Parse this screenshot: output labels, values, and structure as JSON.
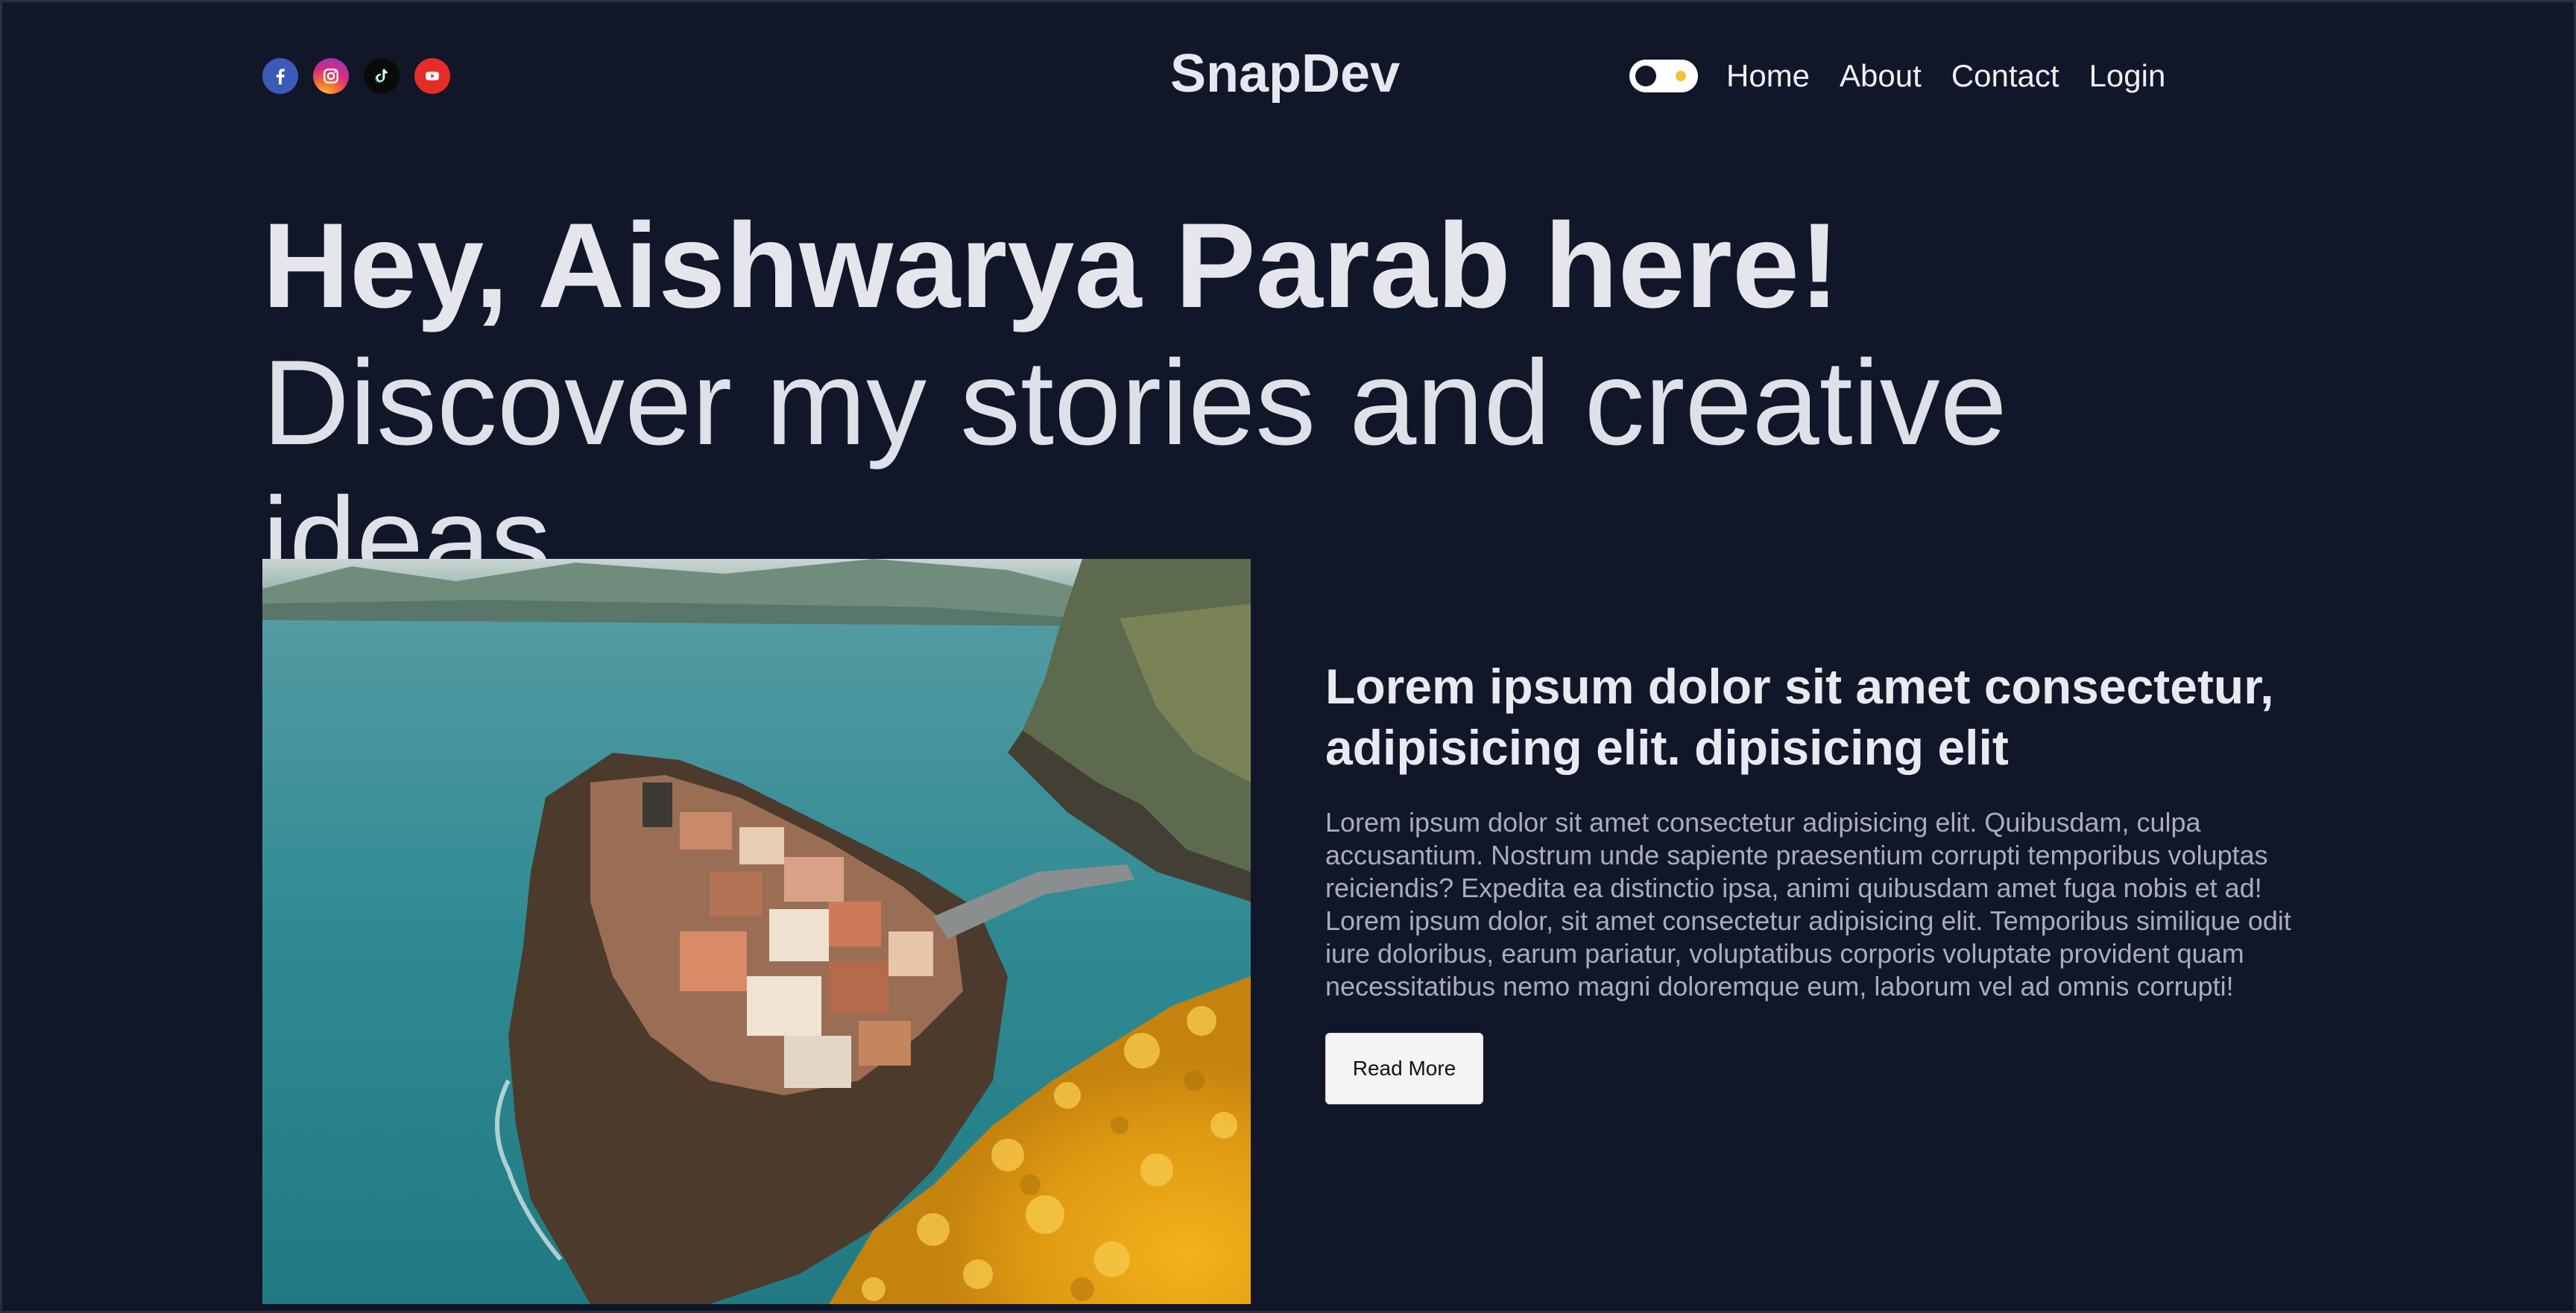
{
  "header": {
    "brand": "SnapDev",
    "socials": [
      {
        "icon": "facebook-icon",
        "color": "#3b5bb7"
      },
      {
        "icon": "instagram-icon",
        "color": "#d62d7c"
      },
      {
        "icon": "tiktok-icon",
        "color": "#0a0a0a"
      },
      {
        "icon": "youtube-icon",
        "color": "#e52d27"
      }
    ],
    "theme_toggle": {
      "icon": "sun-icon",
      "state": "dark"
    },
    "nav": [
      "Home",
      "About",
      "Contact",
      "Login"
    ]
  },
  "hero": {
    "bold": "Hey, Aishwarya Parab here!",
    "light": "Discover my stories and creative ideas."
  },
  "featured": {
    "image": "coastal-village-photo",
    "title": "Lorem ipsum dolor sit amet consectetur, adipisicing elit. dipisicing elit",
    "body": "Lorem ipsum dolor sit amet consectetur adipisicing elit. Quibusdam, culpa accusantium. Nostrum unde sapiente praesentium corrupti temporibus voluptas reiciendis? Expedita ea distinctio ipsa, animi quibusdam amet fuga nobis et ad! Lorem ipsum dolor, sit amet consectetur adipisicing elit. Temporibus similique odit iure doloribus, earum pariatur, voluptatibus corporis voluptate provident quam necessitatibus nemo magni doloremque eum, laborum vel ad omnis corrupti!",
    "button": "Read More"
  },
  "colors": {
    "background": "#121629",
    "heading": "#e4e6ec",
    "body_text": "#a8acbb",
    "accent_sun": "#f2c233"
  }
}
